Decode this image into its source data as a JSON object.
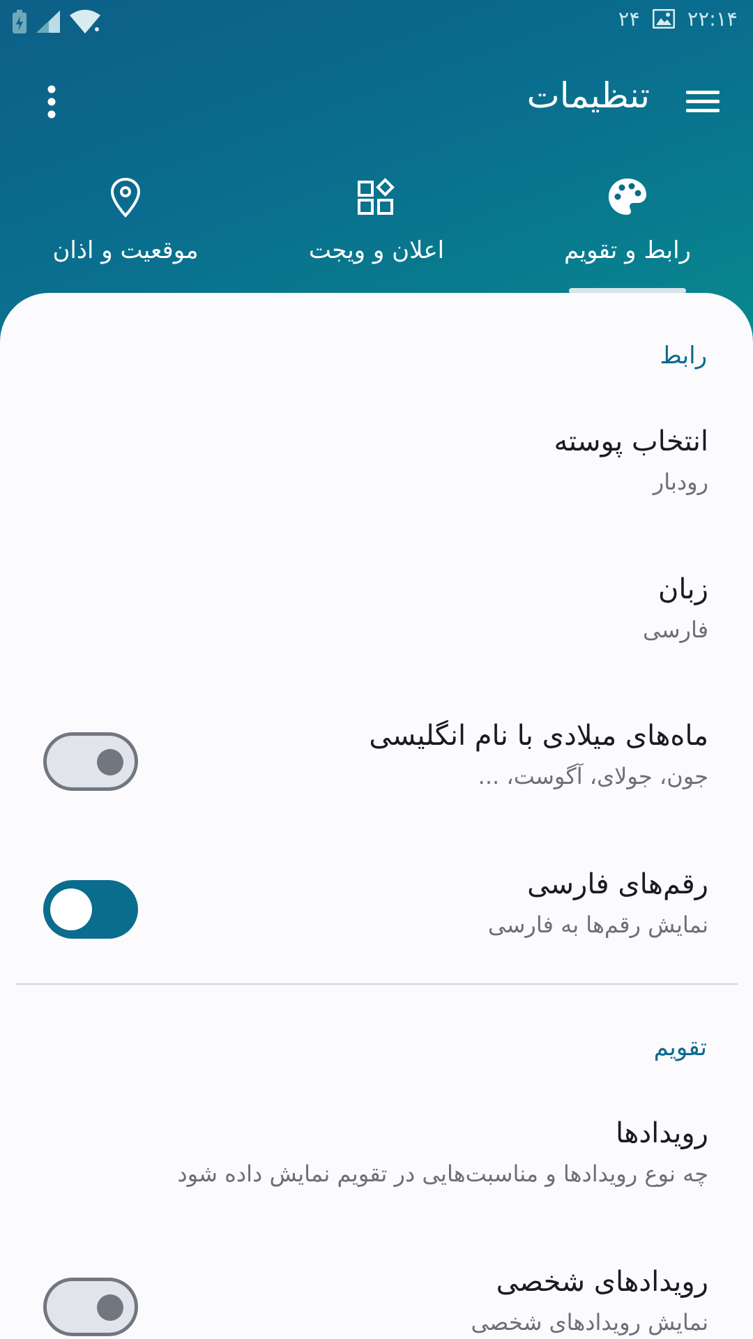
{
  "status_bar": {
    "time": "۲۲:۱۴",
    "date_badge": "۲۴",
    "icons": [
      "battery-charging-icon",
      "signal-icon",
      "wifi-icon",
      "image-icon"
    ]
  },
  "app_bar": {
    "title": "تنظیمات",
    "menu_icon": "hamburger-menu-icon",
    "overflow_icon": "more-vert-icon"
  },
  "tabs": [
    {
      "label": "رابط و تقویم",
      "icon": "palette-icon",
      "selected": true
    },
    {
      "label": "اعلان و ویجت",
      "icon": "widgets-icon",
      "selected": false
    },
    {
      "label": "موقعیت و اذان",
      "icon": "location-pin-icon",
      "selected": false
    }
  ],
  "sections": {
    "interface": {
      "title": "رابط",
      "items": [
        {
          "title": "انتخاب پوسته",
          "subtitle": "رودبار"
        },
        {
          "title": "زبان",
          "subtitle": "فارسی"
        },
        {
          "title": "ماه‌های میلادی با نام انگلیسی",
          "subtitle": "جون، جولای، آگوست، ...",
          "toggle": false
        },
        {
          "title": "رقم‌های فارسی",
          "subtitle": "نمایش رقم‌ها به فارسی",
          "toggle": true
        }
      ]
    },
    "calendar": {
      "title": "تقویم",
      "items": [
        {
          "title": "رویدادها",
          "subtitle": "چه نوع رویدادها و مناسبت‌هایی در تقویم نمایش داده شود"
        },
        {
          "title": "رویدادهای شخصی",
          "subtitle": "نمایش رویدادهای شخصی",
          "toggle": false
        }
      ]
    }
  },
  "colors": {
    "header_start": "#0d5f87",
    "header_end": "#07888f",
    "accent": "#0a6d8e",
    "surface": "#fbfbfe",
    "switch_off_track": "#e1e4ea",
    "switch_off_outline": "#72777f"
  }
}
